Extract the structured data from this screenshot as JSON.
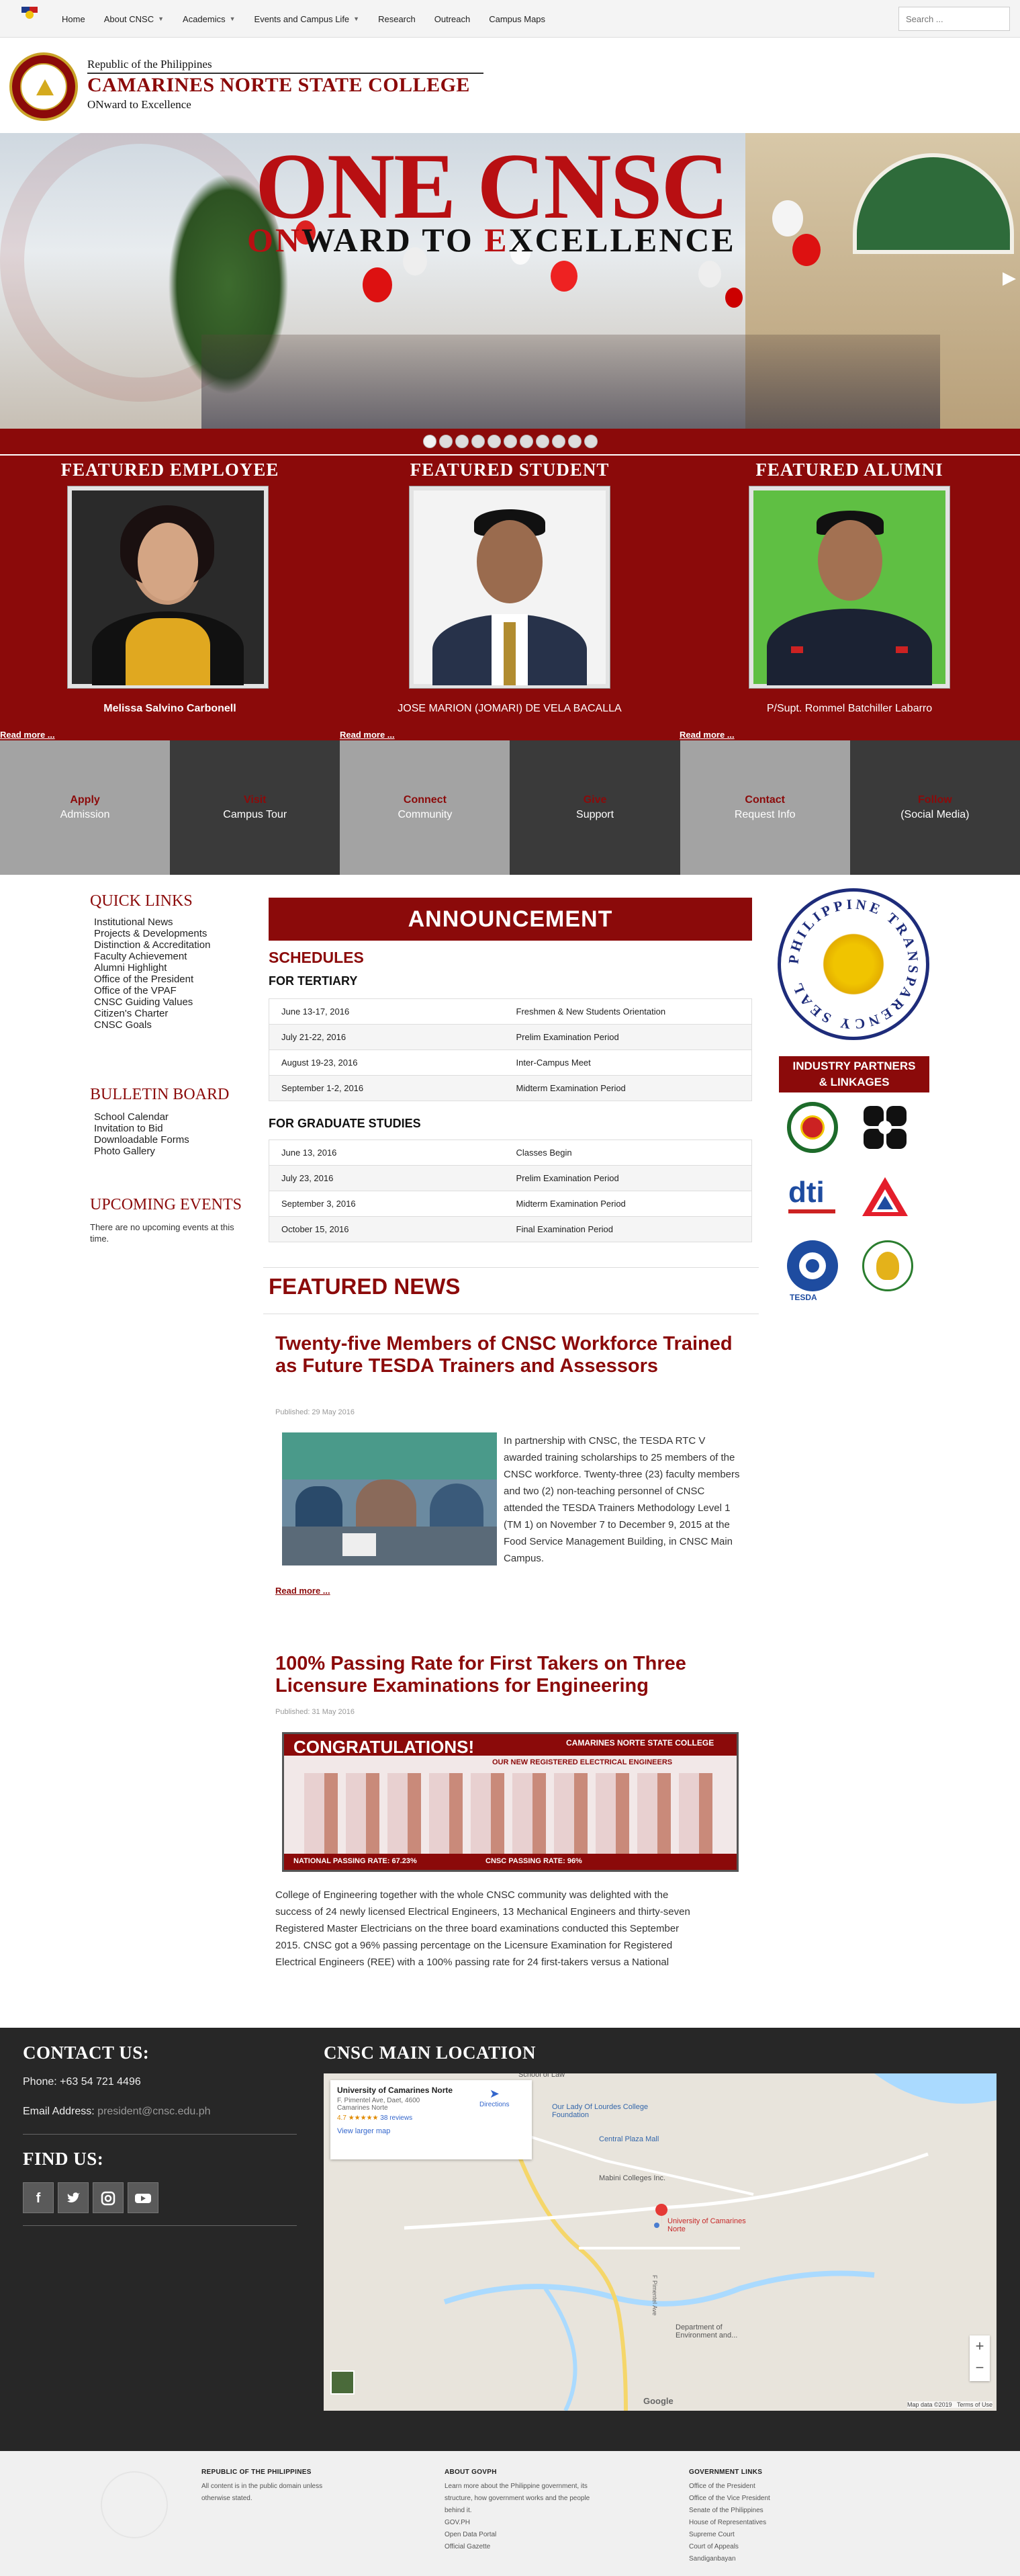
{
  "nav": {
    "items": [
      {
        "label": "Home",
        "dropdown": false
      },
      {
        "label": "About CNSC",
        "dropdown": true
      },
      {
        "label": "Academics",
        "dropdown": true
      },
      {
        "label": "Events and Campus Life",
        "dropdown": true
      },
      {
        "label": "Research",
        "dropdown": false
      },
      {
        "label": "Outreach",
        "dropdown": false
      },
      {
        "label": "Campus Maps",
        "dropdown": false
      }
    ],
    "search_placeholder": "Search ..."
  },
  "header": {
    "republic": "Republic of the Philippines",
    "college": "CAMARINES NORTE STATE COLLEGE",
    "motto": "ONward to Excellence"
  },
  "hero": {
    "title": "ONE CNSC",
    "subtitle_parts": [
      "ON",
      "WARD TO ",
      "E",
      "XCELLENCE"
    ]
  },
  "featured": {
    "employee": {
      "title": "FEATURED EMPLOYEE",
      "name": "Melissa Salvino Carbonell"
    },
    "student": {
      "title": "FEATURED STUDENT",
      "name": "JOSE MARION (JOMARI) DE VELA BACALLA"
    },
    "alumni": {
      "title": "FEATURED ALUMNI",
      "name": "P/Supt. Rommel Batchiller Labarro"
    },
    "read_more": "Read more ..."
  },
  "tiles": [
    {
      "title": "Apply",
      "sub": "Admission",
      "bg": "#a3a3a3"
    },
    {
      "title": "Visit",
      "sub": "Campus Tour",
      "bg": "#3a3a3a"
    },
    {
      "title": "Connect",
      "sub": "Community",
      "bg": "#a3a3a3"
    },
    {
      "title": "Give",
      "sub": "Support",
      "bg": "#3a3a3a"
    },
    {
      "title": "Contact",
      "sub": "Request Info",
      "bg": "#a3a3a3"
    },
    {
      "title": "Follow",
      "sub": "(Social Media)",
      "bg": "#3a3a3a"
    }
  ],
  "quick_links": {
    "title": "QUICK LINKS",
    "items": [
      "Institutional News",
      "Projects & Developments",
      "Distinction & Accreditation",
      "Faculty Achievement",
      "Alumni Highlight",
      "Office of the President",
      "Office of the VPAF",
      "CNSC Guiding Values",
      "Citizen's Charter",
      "CNSC Goals"
    ]
  },
  "bulletin": {
    "title": "BULLETIN BOARD",
    "items": [
      "School Calendar",
      "Invitation to Bid",
      "Downloadable Forms",
      "Photo Gallery"
    ]
  },
  "upcoming": {
    "title": "UPCOMING EVENTS",
    "text": "There are no upcoming events at this time."
  },
  "announcement": {
    "title": "ANNOUNCEMENT",
    "schedules": "SCHEDULES",
    "tertiary_title": "FOR TERTIARY",
    "tertiary": [
      [
        "June 13-17, 2016",
        "Freshmen & New Students Orientation"
      ],
      [
        "July 21-22, 2016",
        "Prelim Examination Period"
      ],
      [
        "August 19-23, 2016",
        "Inter-Campus Meet"
      ],
      [
        "September 1-2, 2016",
        "Midterm Examination Period"
      ]
    ],
    "graduate_title": "FOR GRADUATE STUDIES",
    "graduate": [
      [
        "June 13, 2016",
        "Classes Begin"
      ],
      [
        "July 23, 2016",
        "Prelim Examination Period"
      ],
      [
        "September 3, 2016",
        "Midterm Examination Period"
      ],
      [
        "October 15, 2016",
        "Final Examination Period"
      ]
    ]
  },
  "transparency": {
    "text": "PHILIPPINE TRANSPARENCY SEAL"
  },
  "partners": {
    "title_line1": "INDUSTRY PARTNERS",
    "title_line2": "& LINKAGES",
    "tesda": "TESDA",
    "dti": "dti"
  },
  "news": {
    "title": "FEATURED NEWS",
    "articles": [
      {
        "title": "Twenty-five Members of CNSC Workforce Trained as Future TESDA Trainers and Assessors",
        "published": "Published: 29 May 2016",
        "body": "In partnership with CNSC, the TESDA RTC V awarded training scholarships to 25 members of the CNSC workforce. Twenty-three (23) faculty members and two (2) non-teaching personnel of CNSC attended the TESDA Trainers Methodology Level 1 (TM 1) on November 7 to December 9, 2015 at the Food Service Management Building, in CNSC Main Campus.",
        "read_more": "Read more ..."
      },
      {
        "title": "100% Passing Rate for First Takers on Three Licensure Examinations for Engineering",
        "published": "Published: 31 May 2016",
        "banner_title": "CONGRATULATIONS!",
        "banner_college": "CAMARINES NORTE STATE COLLEGE",
        "banner_sub": "OUR NEW REGISTERED ELECTRICAL ENGINEERS",
        "banner_rate1": "NATIONAL PASSING RATE: 67.23%",
        "banner_rate2": "CNSC PASSING RATE: 96%",
        "body": "College of Engineering together with the whole CNSC community was delighted with the success of 24 newly licensed Electrical Engineers, 13 Mechanical Engineers and thirty-seven Registered Master Electricians on the three board examinations conducted this September 2015. CNSC got a 96% passing percentage on the Licensure Examination for Registered Electrical Engineers (REE) with a 100% passing rate for 24 first-takers versus a National"
      }
    ]
  },
  "contact": {
    "title": "CONTACT US:",
    "phone_label": "Phone:",
    "phone": "+63 54 721 4496",
    "email_label": "Email Address:",
    "email": "president@cnsc.edu.ph",
    "find_title": "FIND US:",
    "social": [
      "f",
      "t",
      "ig",
      "yt"
    ]
  },
  "map": {
    "title": "CNSC MAIN LOCATION",
    "place": "University of Camarines Norte",
    "address": "F. Pimentel Ave, Daet, 4600 Camarines Norte",
    "rating": "4.7",
    "stars": "★★★★★",
    "reviews": "38 reviews",
    "directions": "Directions",
    "larger": "View larger map",
    "labels": [
      "School of Law",
      "Our Lady Of Lourdes College Foundation",
      "Central Plaza Mall",
      "Mabini Colleges Inc.",
      "University of Camarines Norte",
      "Department of Environment and...",
      "F Pimentel Ave"
    ],
    "footer_data": "Map data ©2019",
    "footer_terms": "Terms of Use",
    "google": "Google"
  },
  "footer": {
    "col1_title": "REPUBLIC OF THE PHILIPPINES",
    "col1_text": "All content is in the public domain unless otherwise stated.",
    "col2_title": "ABOUT GOVPH",
    "col2_text": "Learn more about the Philippine government, its structure, how government works and the people behind it.",
    "col2_links": [
      "GOV.PH",
      "Open Data Portal",
      "Official Gazette"
    ],
    "col3_title": "GOVERNMENT LINKS",
    "col3_links": [
      "Office of the President",
      "Office of the Vice President",
      "Senate of the Philippines",
      "House of Representatives",
      "Supreme Court",
      "Court of Appeals",
      "Sandiganbayan"
    ]
  },
  "colors": {
    "maroon": "#8b0a0a",
    "dark": "#272727"
  }
}
